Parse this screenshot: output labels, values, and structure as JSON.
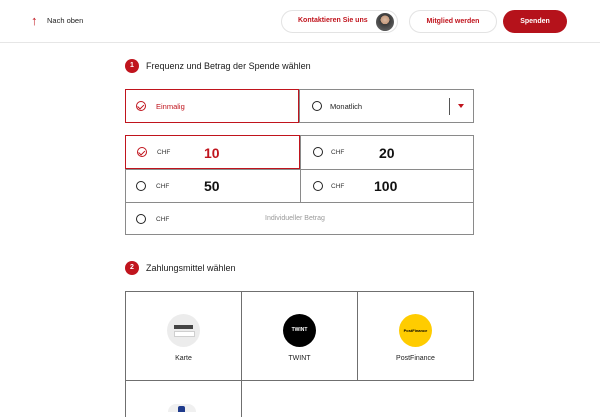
{
  "header": {
    "back_label": "Nach oben",
    "contact_label": "Kontaktieren Sie uns",
    "member_label": "Mitglied werden",
    "donate_label": "Spenden"
  },
  "step1": {
    "number": "1",
    "title": "Frequenz und Betrag der Spende wählen",
    "frequency": {
      "options": [
        {
          "label": "Einmalig",
          "selected": true
        },
        {
          "label": "Monatlich",
          "selected": false
        }
      ]
    },
    "amounts": [
      {
        "currency": "CHF",
        "value": "10",
        "selected": true
      },
      {
        "currency": "CHF",
        "value": "20",
        "selected": false
      },
      {
        "currency": "CHF",
        "value": "50",
        "selected": false
      },
      {
        "currency": "CHF",
        "value": "100",
        "selected": false
      }
    ],
    "custom": {
      "currency": "CHF",
      "placeholder": "Individueller Betrag"
    }
  },
  "step2": {
    "number": "2",
    "title": "Zahlungsmittel wählen",
    "methods": [
      {
        "label": "Karte",
        "icon": "credit-card-icon"
      },
      {
        "label": "TWINT",
        "icon": "twint-logo-icon",
        "logo_text": "TWINT"
      },
      {
        "label": "PostFinance",
        "icon": "postfinance-logo-icon",
        "logo_text": "PostFinance"
      },
      {
        "label": "",
        "icon": "paypal-logo-icon"
      }
    ]
  },
  "colors": {
    "accent": "#c0141d",
    "donate_bg": "#b5121b",
    "border": "#8a8a8a"
  }
}
